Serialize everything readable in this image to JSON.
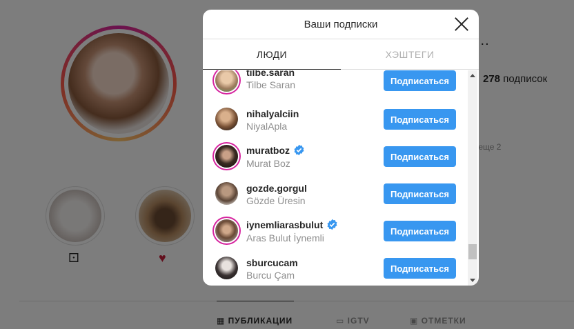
{
  "background": {
    "dots": "...",
    "stats": {
      "count": "278",
      "label": "подписок"
    },
    "more": "· еще 2",
    "highlights": [
      {
        "glyph": "⚀"
      },
      {
        "glyph": "♥"
      }
    ],
    "profile_tabs": [
      {
        "icon": "grid-icon",
        "label": "ПУБЛИКАЦИИ",
        "active": true
      },
      {
        "icon": "tv-icon",
        "label": "IGTV",
        "active": false
      },
      {
        "icon": "tag-icon",
        "label": "ОТМЕТКИ",
        "active": false
      }
    ]
  },
  "modal": {
    "title": "Ваши подписки",
    "tabs": [
      {
        "label": "ЛЮДИ",
        "active": true
      },
      {
        "label": "ХЭШТЕГИ",
        "active": false
      }
    ],
    "users": [
      {
        "username": "tilbe.saran",
        "name": "Tilbe Saran",
        "verified": false,
        "story": true,
        "button": "Подписаться"
      },
      {
        "username": "nihalyalciin",
        "name": "NiyalApla",
        "verified": false,
        "story": false,
        "button": "Подписаться"
      },
      {
        "username": "muratboz",
        "name": "Murat Boz",
        "verified": true,
        "story": true,
        "button": "Подписаться"
      },
      {
        "username": "gozde.gorgul",
        "name": "Gözde Üresin",
        "verified": false,
        "story": false,
        "button": "Подписаться"
      },
      {
        "username": "iynemliarasbulut",
        "name": "Aras Bulut İynemli",
        "verified": true,
        "story": true,
        "button": "Подписаться"
      },
      {
        "username": "sburcucam",
        "name": "Burcu Çam",
        "verified": false,
        "story": false,
        "button": "Подписаться"
      }
    ]
  },
  "colors": {
    "accent": "#3897f0",
    "story_ring": "#d6249f",
    "verified": "#3897f0"
  }
}
